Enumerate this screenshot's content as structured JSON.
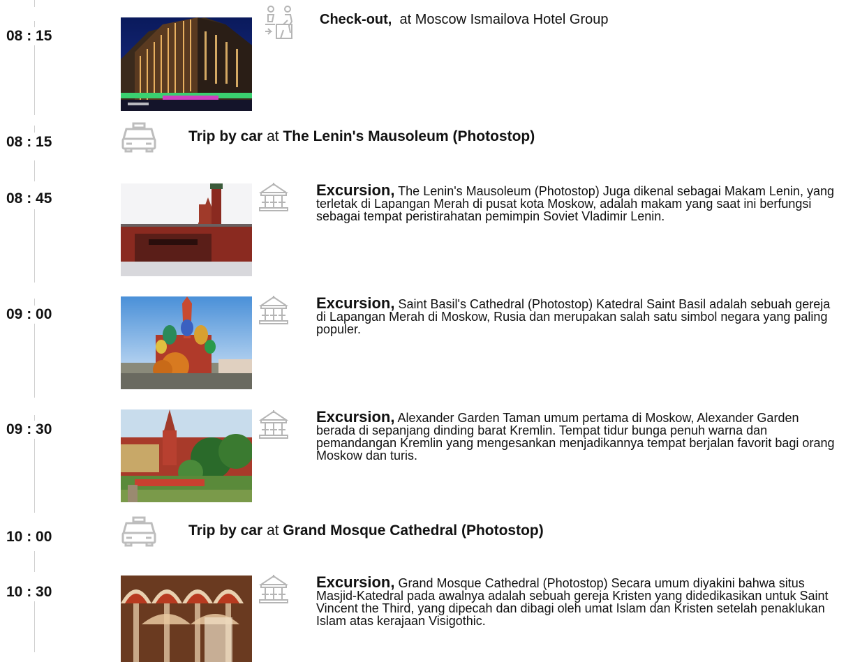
{
  "itinerary": [
    {
      "time": "08 : 15",
      "type": "checkout",
      "title": "Check-out,",
      "text": "at Moscow Ismailova Hotel Group",
      "icon": "person-walking-out-icon",
      "photo": "hotel-photo"
    },
    {
      "time": "08 : 15",
      "type": "trip",
      "title": "Trip by car",
      "connector": "at",
      "place": "The Lenin's Mausoleum (Photostop)",
      "icon": "taxi-icon"
    },
    {
      "time": "08 : 45",
      "type": "excursion",
      "title": "Excursion,",
      "text": "The Lenin's Mausoleum (Photostop) Juga dikenal sebagai Makam Lenin, yang terletak di Lapangan Merah di pusat kota Moskow, adalah makam yang saat ini berfungsi sebagai tempat peristirahatan pemimpin Soviet Vladimir Lenin.",
      "icon": "carousel-icon",
      "photo": "mausoleum-photo"
    },
    {
      "time": "09 : 00",
      "type": "excursion",
      "title": "Excursion,",
      "text": "Saint Basil's Cathedral (Photostop) Katedral Saint Basil adalah sebuah gereja di Lapangan Merah di Moskow, Rusia dan merupakan salah satu simbol negara yang paling populer.",
      "icon": "carousel-icon",
      "photo": "cathedral-photo"
    },
    {
      "time": "09 : 30",
      "type": "excursion",
      "title": "Excursion,",
      "text": "Alexander Garden Taman umum pertama di Moskow, Alexander Garden berada di sepanjang dinding barat Kremlin. Tempat tidur bunga penuh warna dan pemandangan Kremlin yang mengesankan menjadikannya tempat berjalan favorit bagi orang Moskow dan turis.",
      "icon": "carousel-icon",
      "photo": "garden-photo"
    },
    {
      "time": "10 : 00",
      "type": "trip",
      "title": "Trip by car",
      "connector": "at",
      "place": "Grand Mosque Cathedral (Photostop)",
      "icon": "taxi-icon"
    },
    {
      "time": "10 : 30",
      "type": "excursion",
      "title": "Excursion,",
      "text": "Grand Mosque Cathedral (Photostop) Secara umum diyakini bahwa situs Masjid-Katedral pada awalnya adalah sebuah gereja Kristen yang didedikasikan untuk Saint Vincent the Third, yang dipecah dan dibagi oleh umat Islam dan Kristen setelah penaklukan Islam atas kerajaan Visigothic.",
      "icon": "carousel-icon",
      "photo": "mosque-photo"
    }
  ]
}
